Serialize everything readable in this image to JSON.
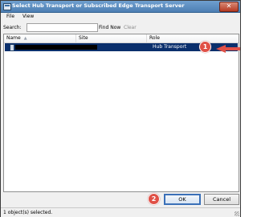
{
  "window": {
    "title": "Select Hub Transport or Subscribed Edge Transport Server",
    "close_glyph": "✕"
  },
  "menu": {
    "items": [
      {
        "label": "File"
      },
      {
        "label": "View"
      }
    ]
  },
  "search": {
    "label": "Search:",
    "value": "",
    "find_now": "Find Now",
    "clear": "Clear"
  },
  "list": {
    "columns": [
      {
        "label": "Name"
      },
      {
        "label": "Site"
      },
      {
        "label": "Role"
      }
    ],
    "rows": [
      {
        "name": "",
        "site": "",
        "role": "Hub Transport",
        "selected": true
      }
    ]
  },
  "annotations": {
    "marker1": "1",
    "marker2": "2",
    "marker_color": "#e05046"
  },
  "buttons": {
    "ok": "OK",
    "cancel": "Cancel"
  },
  "status": {
    "text": "1 object(s) selected."
  },
  "colors": {
    "selection": "#0a2f6c",
    "titlebar": "#4d7fb3"
  }
}
